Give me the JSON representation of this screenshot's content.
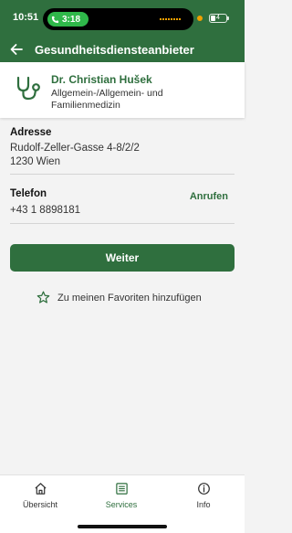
{
  "status_bar": {
    "time": "10:51",
    "call_duration": "3:18",
    "battery_level": "4"
  },
  "app_bar": {
    "title": "Gesundheitsdiensteanbieter",
    "back_icon": "arrow-left-icon"
  },
  "provider": {
    "name": "Dr. Christian Hušek",
    "specialty": "Allgemein-/Allgemein- und Familienmedizin",
    "icon": "stethoscope-icon"
  },
  "address": {
    "label": "Adresse",
    "line1": "Rudolf-Zeller-Gasse 4-8/2/2",
    "line2": "1230 Wien"
  },
  "phone": {
    "label": "Telefon",
    "number": "+43 1 8898181",
    "call_label": "Anrufen"
  },
  "actions": {
    "continue_label": "Weiter",
    "favorite_label": "Zu meinen Favoriten hinzufügen"
  },
  "tabs": [
    {
      "label": "Übersicht",
      "icon": "home-icon",
      "active": false
    },
    {
      "label": "Services",
      "icon": "services-icon",
      "active": true
    },
    {
      "label": "Info",
      "icon": "info-icon",
      "active": false
    }
  ],
  "colors": {
    "primary": "#2f6f3e",
    "background": "#f3f3f3",
    "call_pill": "#2fb84a"
  }
}
